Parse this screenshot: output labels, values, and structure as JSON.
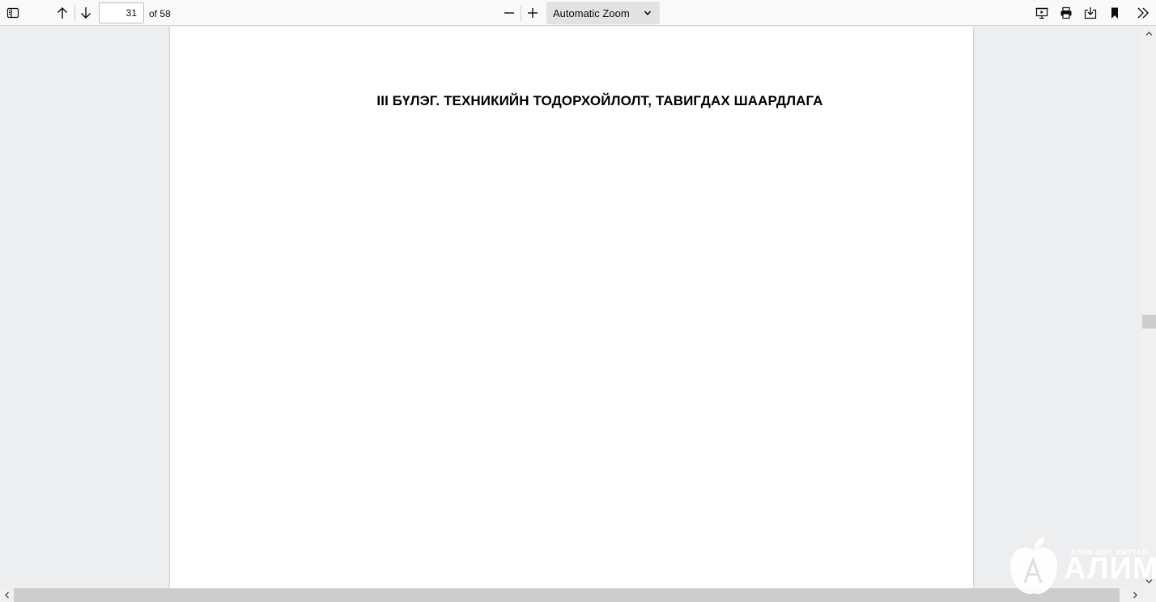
{
  "toolbar": {
    "current_page": "31",
    "page_count_label": "of 58",
    "zoom_value": "Automatic Zoom",
    "icons": {
      "sidebar": "sidebar-toggle-icon",
      "previous": "arrow-up-icon",
      "next": "arrow-down-icon",
      "zoom_out": "minus-icon",
      "zoom_in": "plus-icon",
      "presentation": "presentation-icon",
      "print": "printer-icon",
      "download": "download-icon",
      "bookmark": "bookmark-icon",
      "tools": "double-chevron-right-icon"
    }
  },
  "document": {
    "heading": "III БҮЛЭГ. ТЕХНИКИЙН ТОДОРХОЙЛОЛТ, ТАВИГДАХ ШААРДЛАГА"
  },
  "watermark": {
    "tagline": "АЛИМ МЭТ АМТТАЙ",
    "brand": "АЛИМ"
  },
  "colors": {
    "toolbar_bg": "#f9f9fa",
    "viewer_bg": "#edeef0",
    "page_bg": "#ffffff",
    "zoom_select_bg": "#e2e2e5"
  }
}
